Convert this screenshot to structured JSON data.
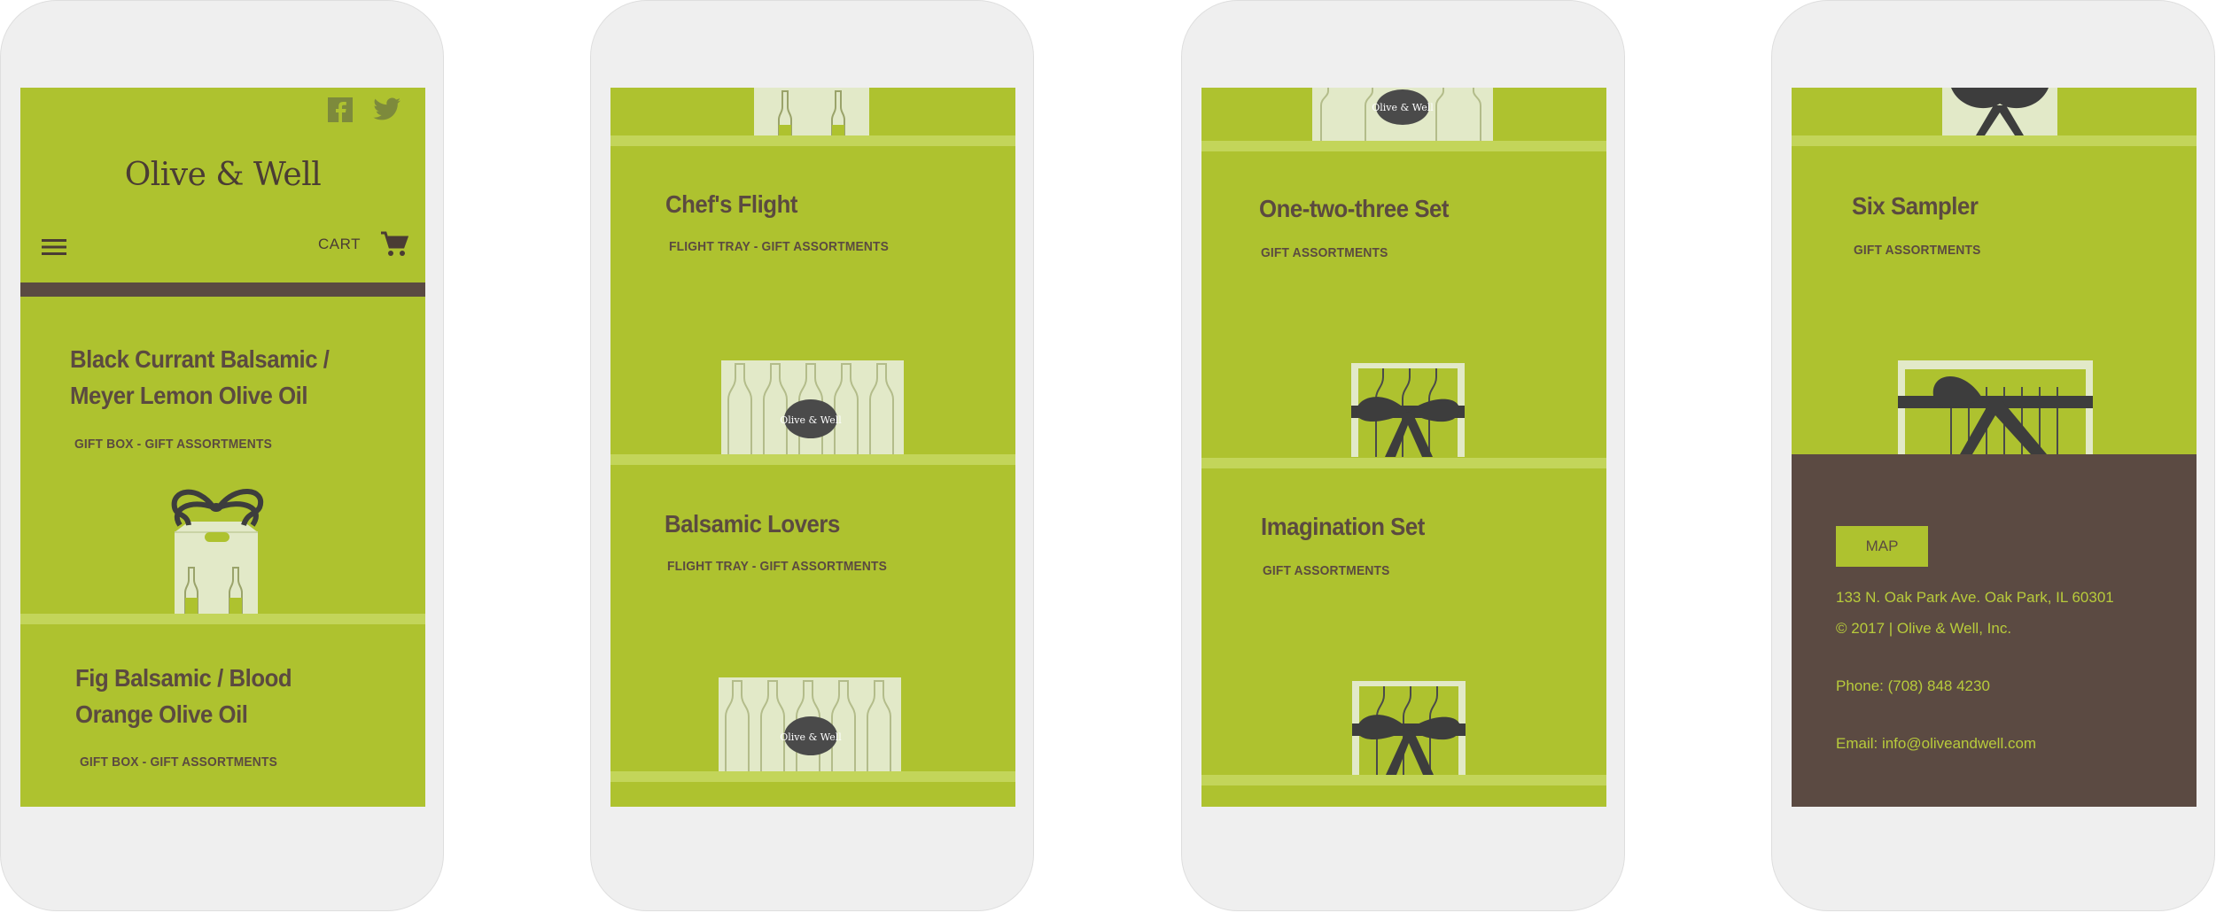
{
  "colors": {
    "accent": "#aec22f",
    "band": "#c3d55a",
    "brown": "#5b4a42",
    "text": "#5b4a40"
  },
  "screens": [
    {
      "header": {
        "brand": "Olive & Well",
        "cart_label": "CART",
        "icons": [
          "facebook-icon",
          "twitter-icon",
          "menu-icon",
          "cart-icon"
        ]
      },
      "products": [
        {
          "title_line1": "Black Currant Balsamic /",
          "title_line2": "Meyer Lemon Olive Oil",
          "subtitle": "GIFT BOX - GIFT ASSORTMENTS"
        },
        {
          "title_line1": "Fig Balsamic / Blood",
          "title_line2": "Orange Olive Oil",
          "subtitle": "GIFT BOX - GIFT ASSORTMENTS"
        }
      ]
    },
    {
      "products": [
        {
          "title": "Chef's Flight",
          "subtitle": "FLIGHT TRAY - GIFT ASSORTMENTS",
          "badge": "Olive & Well"
        },
        {
          "title": "Balsamic Lovers",
          "subtitle": "FLIGHT TRAY - GIFT ASSORTMENTS",
          "badge": "Olive & Well"
        }
      ]
    },
    {
      "top_badge": "Olive & Well",
      "products": [
        {
          "title": "One-two-three Set",
          "subtitle": "GIFT ASSORTMENTS"
        },
        {
          "title": "Imagination Set",
          "subtitle": "GIFT ASSORTMENTS"
        }
      ]
    },
    {
      "products": [
        {
          "title": "Six Sampler",
          "subtitle": "GIFT ASSORTMENTS"
        }
      ],
      "footer": {
        "map_label": "MAP",
        "address": "133 N. Oak Park Ave. Oak Park, IL 60301",
        "copyright": "© 2017 | Olive & Well, Inc.",
        "phone": "Phone: (708) 848 4230",
        "email": "Email: info@oliveandwell.com"
      }
    }
  ]
}
